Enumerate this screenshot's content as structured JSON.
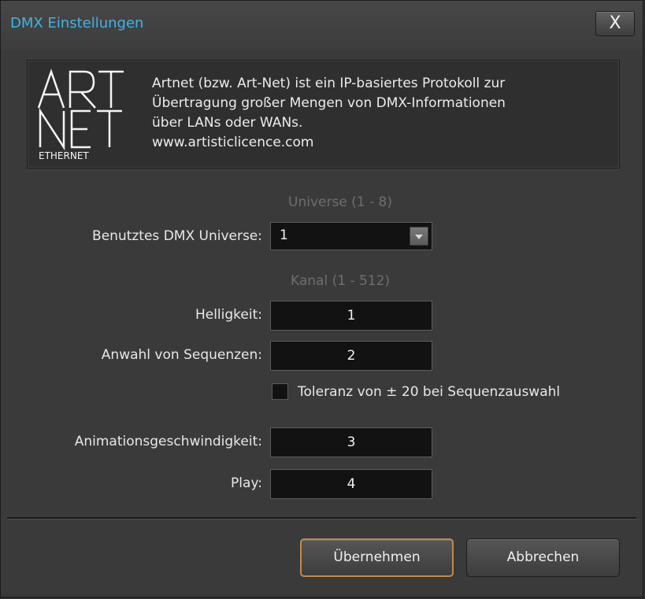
{
  "window": {
    "title": "DMX Einstellungen",
    "close_label": "X"
  },
  "info": {
    "logo": {
      "text_line1": "ART",
      "text_line2": "NET",
      "text_line3": "ETHERNET"
    },
    "lines": [
      "Artnet (bzw. Art-Net) ist ein IP-basiertes Protokoll zur",
      "Übertragung großer Mengen von DMX-Informationen",
      "über LANs oder WANs.",
      "www.artisticlicence.com"
    ]
  },
  "universe": {
    "header": "Universe (1 - 8)",
    "label": "Benutztes DMX Universe:",
    "value": "1"
  },
  "channels": {
    "header": "Kanal (1 - 512)",
    "brightness": {
      "label": "Helligkeit:",
      "value": "1"
    },
    "sequence": {
      "label": "Anwahl von Sequenzen:",
      "value": "2"
    },
    "tolerance_checkbox": {
      "label": "Toleranz von ± 20 bei Sequenzauswahl",
      "checked": false
    },
    "animation_speed": {
      "label": "Animationsgeschwindigkeit:",
      "value": "3"
    },
    "play": {
      "label": "Play:",
      "value": "4"
    }
  },
  "buttons": {
    "apply": "Übernehmen",
    "cancel": "Abbrechen"
  }
}
